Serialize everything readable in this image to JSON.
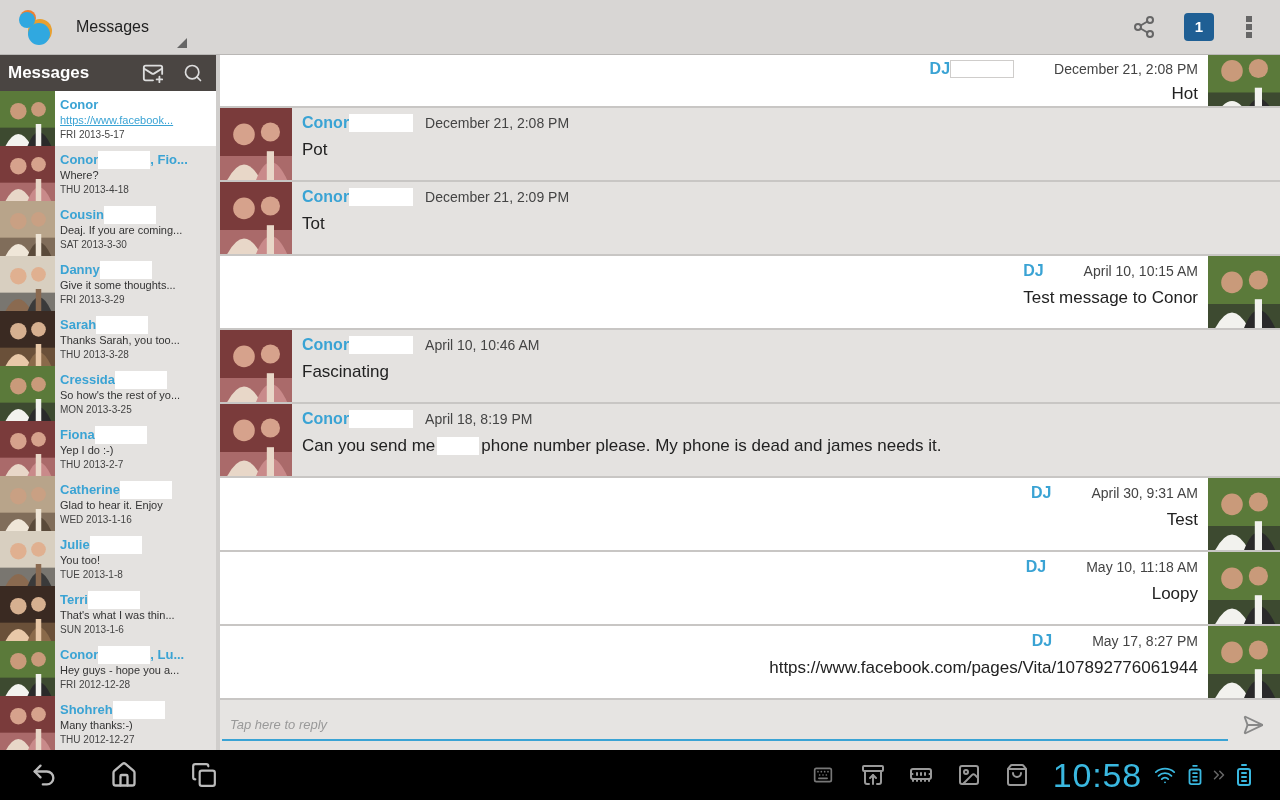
{
  "action_bar": {
    "title": "Messages",
    "notification_count": "1"
  },
  "sidebar": {
    "title": "Messages",
    "conversations": [
      {
        "name": "Conor",
        "redacted": false,
        "preview": "https://www.facebook...",
        "preview_is_link": true,
        "date": "FRI 2013-5-17",
        "selected": true
      },
      {
        "name": "Conor",
        "redacted": true,
        "name_suffix": ", Fio...",
        "preview": "Where?",
        "preview_is_link": false,
        "date": "THU 2013-4-18",
        "selected": false
      },
      {
        "name": "Cousin",
        "redacted": true,
        "preview": "Deaj. If you are coming...",
        "preview_is_link": false,
        "date": "SAT 2013-3-30",
        "selected": false
      },
      {
        "name": "Danny",
        "redacted": true,
        "preview": "Give it some thoughts...",
        "preview_is_link": false,
        "date": "FRI 2013-3-29",
        "selected": false
      },
      {
        "name": "Sarah",
        "redacted": true,
        "preview": "Thanks Sarah, you too...",
        "preview_is_link": false,
        "date": "THU 2013-3-28",
        "selected": false
      },
      {
        "name": "Cressida",
        "redacted": true,
        "preview": "So how's the rest of yo...",
        "preview_is_link": false,
        "date": "MON 2013-3-25",
        "selected": false
      },
      {
        "name": "Fiona",
        "redacted": true,
        "preview": "Yep I do :-)",
        "preview_is_link": false,
        "date": "THU 2013-2-7",
        "selected": false
      },
      {
        "name": "Catherine",
        "redacted": true,
        "preview": "Glad to hear it. Enjoy",
        "preview_is_link": false,
        "date": "WED 2013-1-16",
        "selected": false
      },
      {
        "name": "Julie",
        "redacted": true,
        "preview": "You too!",
        "preview_is_link": false,
        "date": "TUE 2013-1-8",
        "selected": false
      },
      {
        "name": "Terri",
        "redacted": true,
        "preview": "That's what I was thin...",
        "preview_is_link": false,
        "date": "SUN 2013-1-6",
        "selected": false
      },
      {
        "name": "Conor",
        "redacted": true,
        "name_suffix": ", Lu...",
        "preview": "Hey guys - hope you a...",
        "preview_is_link": false,
        "date": "FRI 2012-12-28",
        "selected": false
      },
      {
        "name": "Shohreh",
        "redacted": true,
        "preview": "Many thanks:-)",
        "preview_is_link": false,
        "date": "THU 2012-12-27",
        "selected": false
      }
    ]
  },
  "messages": [
    {
      "kind": "outgoing",
      "sender": "DJ",
      "redacted": true,
      "time": "December 21, 2:08 PM",
      "text_parts": [
        "Hot"
      ]
    },
    {
      "kind": "incoming",
      "sender": "Conor",
      "redacted": true,
      "time": "December 21, 2:08 PM",
      "text_parts": [
        "Pot"
      ]
    },
    {
      "kind": "incoming",
      "sender": "Conor",
      "redacted": true,
      "time": "December 21, 2:09 PM",
      "text_parts": [
        "Tot"
      ]
    },
    {
      "kind": "outgoing",
      "sender": "DJ",
      "redacted": false,
      "time": "April 10, 10:15 AM",
      "text_parts": [
        "Test message to Conor"
      ]
    },
    {
      "kind": "incoming",
      "sender": "Conor",
      "redacted": true,
      "time": "April 10, 10:46 AM",
      "text_parts": [
        "Fascinating"
      ]
    },
    {
      "kind": "incoming",
      "sender": "Conor",
      "redacted": true,
      "time": "April 18, 8:19 PM",
      "text_parts": [
        "Can you send me",
        "phone number please. My phone is dead and james needs it."
      ]
    },
    {
      "kind": "outgoing",
      "sender": "DJ",
      "redacted": false,
      "time": "April 30, 9:31 AM",
      "text_parts": [
        "Test"
      ]
    },
    {
      "kind": "outgoing",
      "sender": "DJ",
      "redacted": false,
      "time": "May 10, 11:18 AM",
      "text_parts": [
        "Loopy"
      ]
    },
    {
      "kind": "outgoing",
      "sender": "DJ",
      "redacted": false,
      "time": "May 17, 8:27 PM",
      "text_parts": [
        "https://www.facebook.com/pages/Vita/107892776061944"
      ]
    }
  ],
  "reply": {
    "placeholder": "Tap here to reply"
  },
  "system_bar": {
    "clock": "10:58"
  }
}
